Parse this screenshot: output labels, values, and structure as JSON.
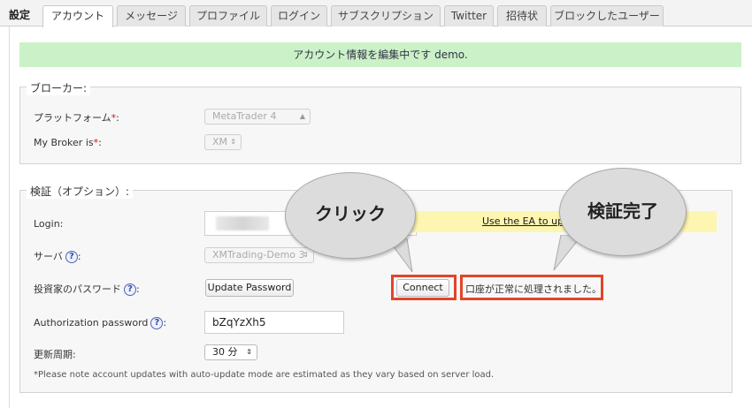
{
  "tabs": {
    "settings_label": "設定",
    "items": [
      {
        "label": "アカウント"
      },
      {
        "label": "メッセージ"
      },
      {
        "label": "プロファイル"
      },
      {
        "label": "ログイン"
      },
      {
        "label": "サブスクリプション"
      },
      {
        "label": "Twitter"
      },
      {
        "label": "招待状"
      },
      {
        "label": "ブロックしたユーザー"
      }
    ]
  },
  "banner": {
    "text": "アカウント情報を編集中です demo."
  },
  "broker": {
    "legend": "ブローカー:",
    "platform_label": "プラットフォーム",
    "platform_value": "MetaTrader 4",
    "broker_label": "My Broker is",
    "broker_value": "XM",
    "required_mark": "*",
    "colon": ":"
  },
  "verify": {
    "legend": "検証（オプション）:",
    "login_label": "Login:",
    "login_value": "",
    "ea_link": "Use the EA to upd",
    "server_label": "サーバ",
    "server_value": "XMTrading-Demo 3",
    "investor_label": "投資家のパスワード",
    "update_password_button": "Update Password",
    "connect_button": "Connect",
    "success_message": "口座が正常に処理されました。",
    "auth_label": "Authorization password",
    "auth_value": "bZqYzXh5",
    "interval_label": "更新周期:",
    "interval_value": "30 分",
    "note": "*Please note account updates with auto-update mode are estimated as they vary based on server load.",
    "help_glyph": "?",
    "colon": ":"
  },
  "callouts": {
    "click": "クリック",
    "verified": "検証完了"
  },
  "colors": {
    "banner_bg": "#cbf1c8",
    "highlight_red": "#e2442b",
    "ea_bar_bg": "#fdf6b0",
    "help_blue": "#3448a8"
  }
}
